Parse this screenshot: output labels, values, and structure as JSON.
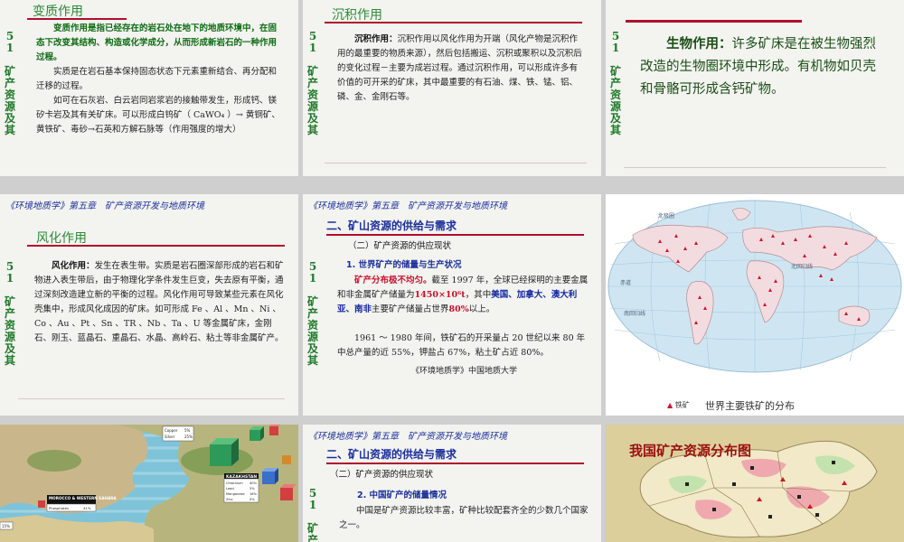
{
  "slide1": {
    "title": "变质作用",
    "side": [
      "5",
      "1",
      "",
      "矿",
      "产",
      "资",
      "源",
      "及",
      "其"
    ],
    "p1": "变质作用是指已经存在的岩石处在地下的地质环境中，在固态下改变其结构、构造或化学成分，从而形成新岩石的一种作用过程。",
    "p2": "实质是在岩石基本保持固态状态下元素重新结合、再分配和迁移的过程。",
    "p3": "如可在石灰岩、白云岩同岩浆岩的接触带发生，形成钙、镁矽卡岩及其有关矿床。可以形成白钨矿（ CaWO₄ ）→ 黄铜矿、黄铁矿、毒砂→石英和方解石脉等（作用强度的增大）"
  },
  "slide2": {
    "title": "沉积作用",
    "side": [
      "5",
      "1",
      "",
      "矿",
      "产",
      "资",
      "源",
      "及",
      "其"
    ],
    "label": "沉积作用：",
    "text": "沉积作用以风化作用为开端（风化产物是沉积作用的最重要的物质来源），然后包括搬运、沉积或聚积以及沉积后的变化过程－主要为成岩过程。通过沉积作用，可以形成许多有价值的可开采的矿床，其中最重要的有石油、煤、铁、锰、铝、磷、金、金刚石等。"
  },
  "slide3": {
    "side": [
      "5",
      "1",
      "",
      "矿",
      "产",
      "资",
      "源",
      "及",
      "其"
    ],
    "label": "生物作用：",
    "text": "许多矿床是在被生物强烈改造的生物圈环境中形成。有机物如贝壳和骨骼可形成含钙矿物。"
  },
  "slide4": {
    "header": "《环境地质学》第五章　矿产资源开发与地质环境",
    "title": "风化作用",
    "side": [
      "5",
      "1",
      "",
      "矿",
      "产",
      "资",
      "源",
      "及",
      "其"
    ],
    "label": "风化作用：",
    "text": "发生在表生带。实质是岩石圈深部形成的岩石和矿物进入表生带后，由于物理化学条件发生巨变，失去原有平衡，通过深刻改造建立新的平衡的过程。风化作用可导致某些元素在风化壳集中，形成风化成因的矿床。如可形成 Fe 、Al 、Mn 、Ni 、Co 、Au 、Pt 、Sn 、TR 、Nb 、Ta 、U 等金属矿床，金刚石、刚玉、蓝晶石、重晶石、水晶、高岭石、粘土等非金属矿产。"
  },
  "slide5": {
    "header": "《环境地质学》第五章　矿产资源开发与地质环境",
    "section": "二、矿山资源的供给与需求",
    "subsection": "（二）矿产资源的供应现状",
    "side": [
      "5",
      "1",
      "",
      "矿",
      "产",
      "资",
      "源",
      "及",
      "其"
    ],
    "point": "1. 世界矿产的储量与生产状况",
    "red1": "矿产分布极不均匀。",
    "t1": "截至 1997 年，全球已经探明的主要金属和非金属矿产储量为",
    "red2": "1450×10⁶t",
    "t2": "，其中",
    "blue1": "美国、加拿大、澳大利亚、南非",
    "t3": "主要矿产储量占世界",
    "red3": "80%",
    "t4": "以上。",
    "p2": "1961 ～ 1980 年间，铁矿石的开采量占 20 世纪以来 80 年中总产量的近 55%，钾盐占 67%，粘土矿占近 80%。",
    "footer": "《环境地质学》中国地质大学"
  },
  "slide6": {
    "legend_symbol": "▲",
    "legend_label": "铁矿",
    "caption": "世界主要铁矿的分布",
    "labels": {
      "arctic": "北极圈",
      "tropic_n": "北回归线",
      "equator": "赤道",
      "tropic_s": "南回归线"
    }
  },
  "slide7": {
    "legend": [
      [
        "Copper",
        "5%"
      ],
      [
        "Silver",
        "25%"
      ]
    ],
    "kaz_title": "KAZAKHSTAN",
    "kaz_rows": [
      [
        "Chromium",
        "40%"
      ],
      [
        "Lead",
        "5%"
      ],
      [
        "Manganese",
        "16%"
      ],
      [
        "Zinc",
        "5%"
      ]
    ],
    "mor_title": "MOROCCO & WESTERN SAHARA",
    "mor_row": [
      "Phosphates",
      "41%"
    ],
    "scale": "15%"
  },
  "slide8": {
    "header": "《环境地质学》第五章　矿产资源开发与地质环境",
    "section": "二、矿山资源的供给与需求",
    "subsection": "（二）矿产资源的供应现状",
    "side": [
      "5",
      "1",
      "",
      "矿",
      "产"
    ],
    "point": "2. 中国矿产的储量情况",
    "text": "中国是矿产资源比较丰富，矿种比较配套齐全的少数几个国家之一。"
  },
  "slide9": {
    "title": "我国矿产资源分布图"
  }
}
